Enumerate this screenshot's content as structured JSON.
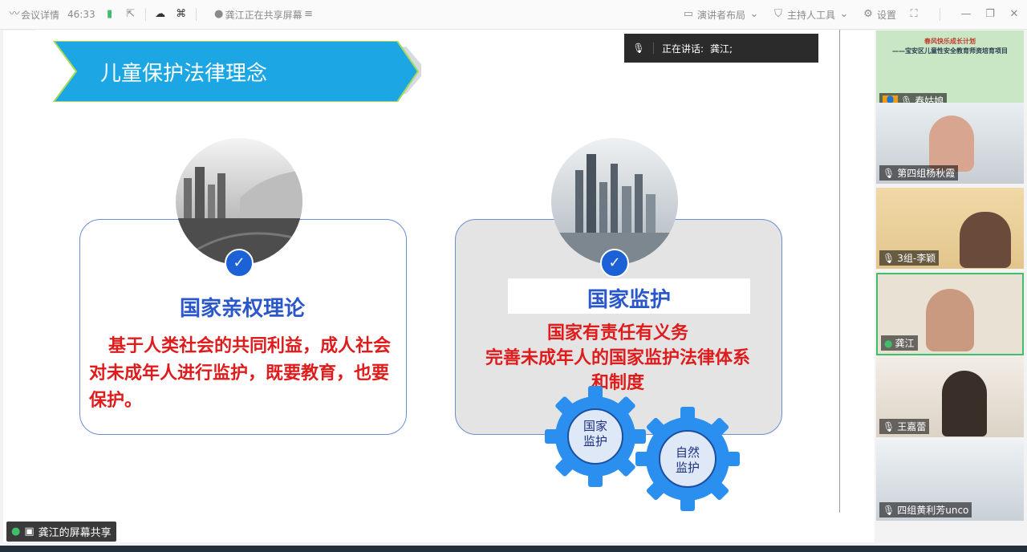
{
  "topbar": {
    "meeting_details": "会议详情",
    "timer": "46:33",
    "sharing_status": "龚江正在共享屏幕",
    "presenter_layout": "演讲者布局",
    "host_tools": "主持人工具",
    "settings": "设置"
  },
  "speaking": {
    "label": "正在讲话:",
    "name": "龚江;"
  },
  "slide": {
    "banner_title": "儿童保护法律理念",
    "left_card": {
      "title": "国家亲权理论",
      "body": "基于人类社会的共同利益，成人社会对未成年人进行监护，既要教育，也要保护。"
    },
    "right_card": {
      "title": "国家监护",
      "body_line1": "国家有责任有义务",
      "body_line2": "完善未成年人的国家监护法律体系",
      "body_line3": "和制度"
    },
    "gear1": {
      "line1": "国家",
      "line2": "监护"
    },
    "gear2": {
      "line1": "自然",
      "line2": "监护"
    }
  },
  "participants": [
    {
      "name": "春姑娘",
      "thumb_title": "春风快乐成长计划",
      "thumb_subtitle": "——宝安区儿童性安全教育师资培育项目"
    },
    {
      "name": "第四组杨秋霞"
    },
    {
      "name": "3组-李颖"
    },
    {
      "name": "龚江"
    },
    {
      "name": "王嘉蕾"
    },
    {
      "name": "四组黄利芳unco"
    }
  ],
  "share_tag": "龚江的屏幕共享",
  "colors": {
    "accent_blue": "#1ca7e4",
    "title_blue": "#2a57c9",
    "text_red": "#e01b1b",
    "active_green": "#3fbf6a"
  }
}
